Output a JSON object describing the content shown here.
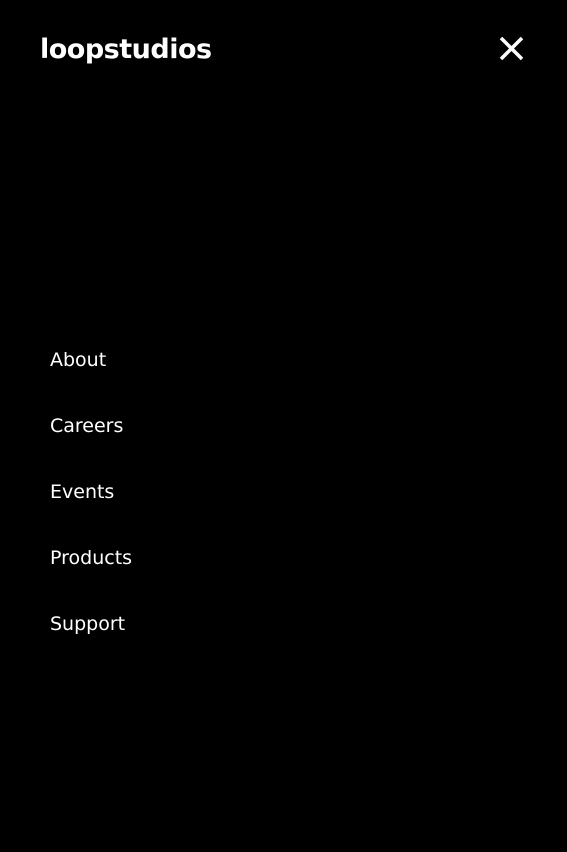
{
  "header": {
    "logo_text": "loopstudios",
    "close_icon": "close-icon"
  },
  "menu": {
    "items": [
      {
        "label": "About"
      },
      {
        "label": "Careers"
      },
      {
        "label": "Events"
      },
      {
        "label": "Products"
      },
      {
        "label": "Support"
      }
    ]
  },
  "colors": {
    "background": "#000000",
    "text": "#ffffff"
  }
}
